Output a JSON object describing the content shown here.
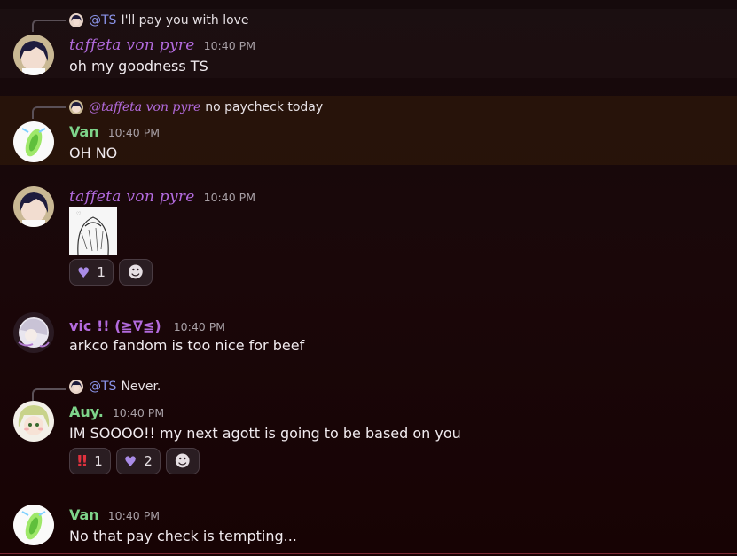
{
  "messages": [
    {
      "reply": {
        "mention": "@TS",
        "text": "I'll pay you with love"
      },
      "author": "taffeta von pyre",
      "time": "10:40 PM",
      "text": "oh my goodness TS"
    },
    {
      "reply": {
        "mention": "@taffeta von pyre",
        "text": "no paycheck today"
      },
      "author": "Van",
      "time": "10:40 PM",
      "text": "OH NO"
    },
    {
      "author": "taffeta von pyre",
      "time": "10:40 PM",
      "reactions": [
        {
          "emoji": "heart",
          "count": "1"
        }
      ]
    },
    {
      "author": "vic !!  (≧∇≦)",
      "time": "10:40 PM",
      "text": "arkco fandom is too nice for beef"
    },
    {
      "reply": {
        "mention": "@TS",
        "text": "Never."
      },
      "author": "Auy.",
      "time": "10:40 PM",
      "text": "IM SOOOO!! my next agott is going to be based on you",
      "reactions": [
        {
          "emoji": "double-exclamation",
          "count": "1"
        },
        {
          "emoji": "heart",
          "count": "2"
        }
      ]
    },
    {
      "author": "Van",
      "time": "10:40 PM",
      "text": "No that pay check is tempting..."
    }
  ],
  "colors": {
    "purple_name": "#b36bde",
    "green_name": "#7ed48a",
    "mention": "#8a93e8"
  }
}
